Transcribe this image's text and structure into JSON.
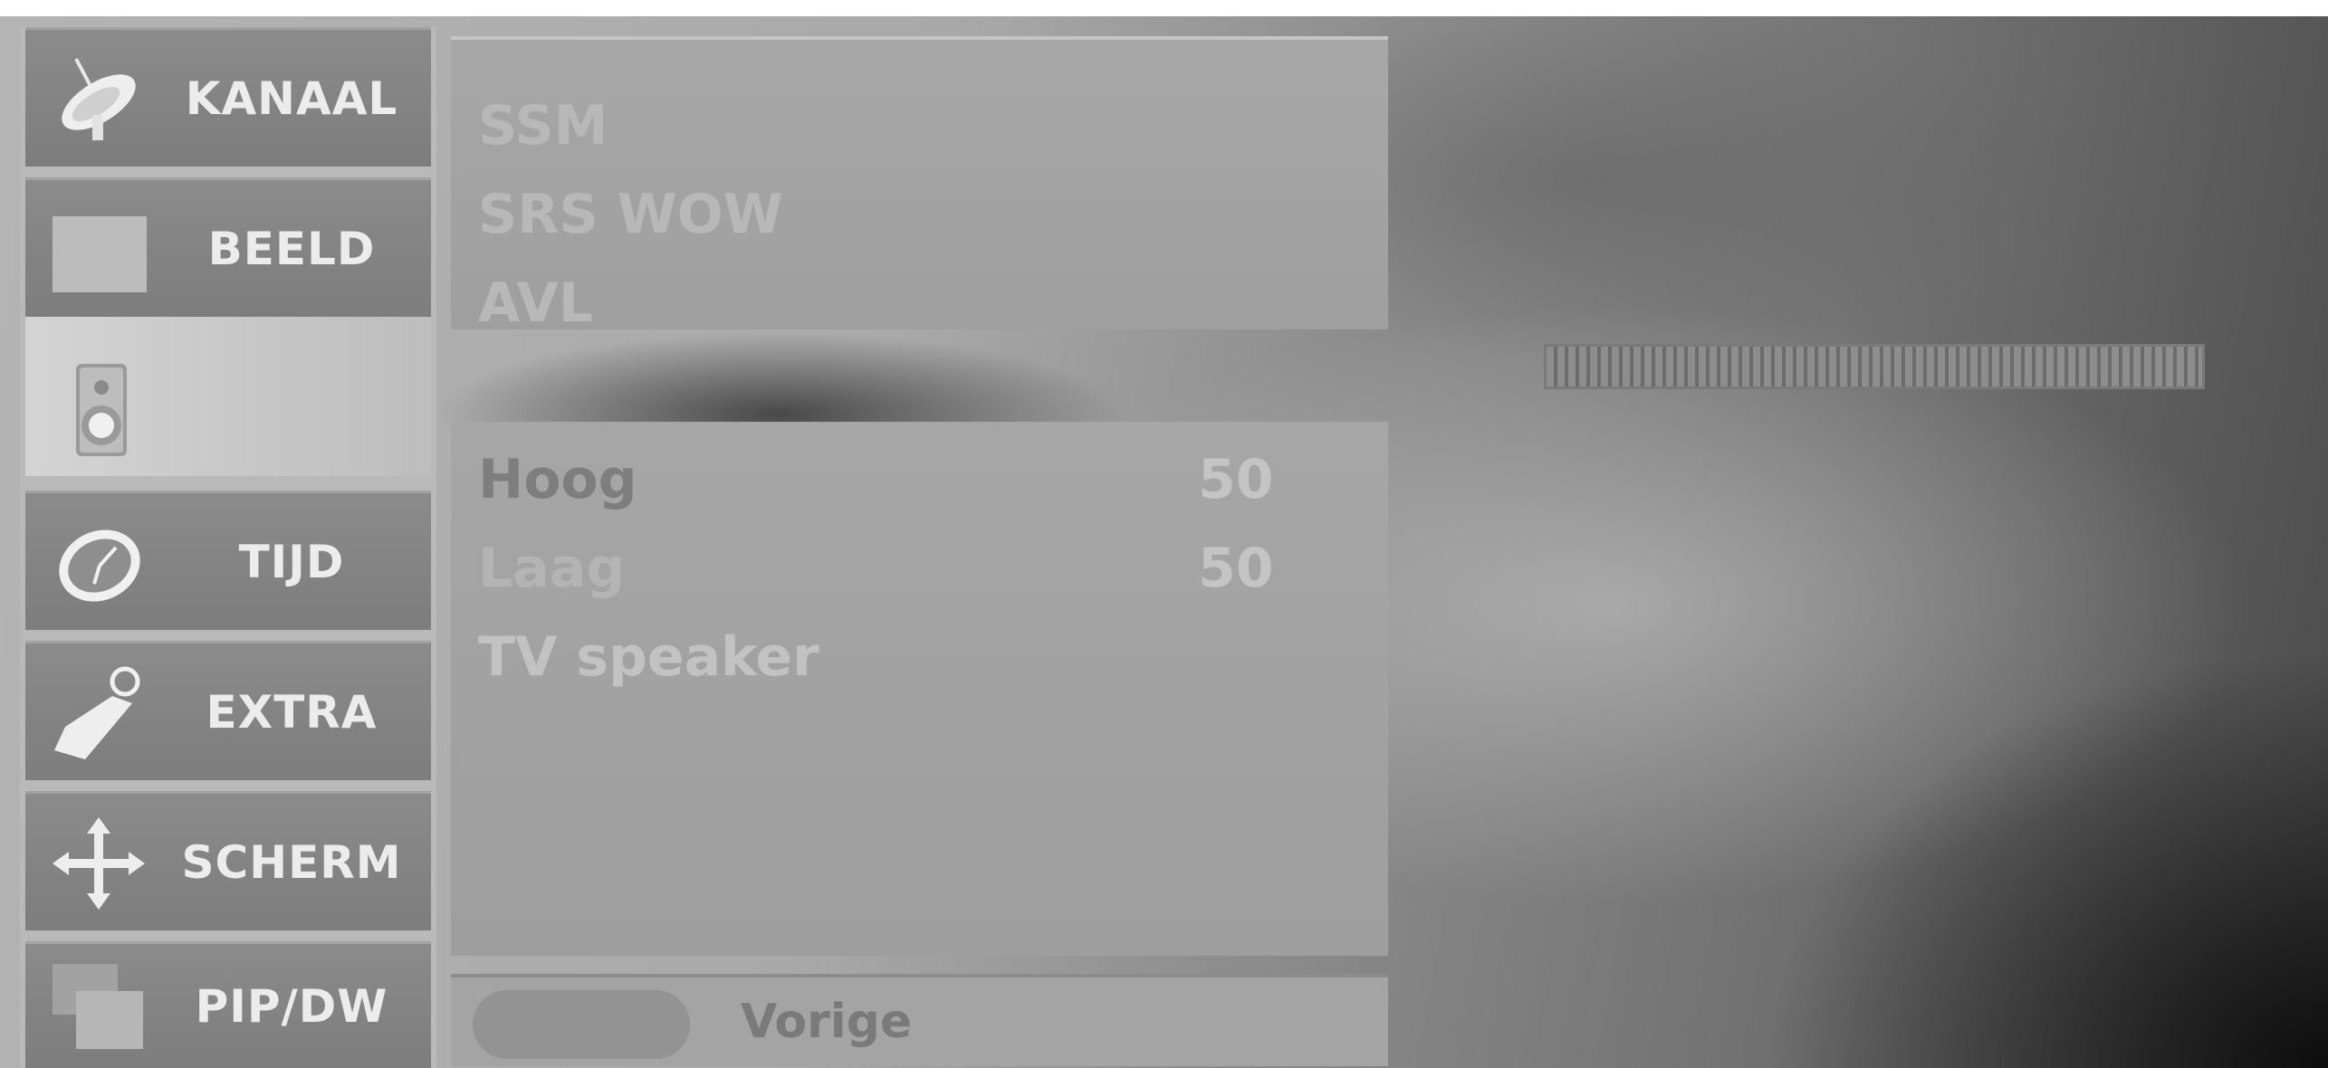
{
  "sidebar": {
    "items": [
      {
        "label": "KANAAL",
        "icon": "satellite-dish-icon"
      },
      {
        "label": "BEELD",
        "icon": "picture-square-icon"
      },
      {
        "label": "",
        "icon": "speaker-icon",
        "selected": true
      },
      {
        "label": "TIJD",
        "icon": "clock-icon"
      },
      {
        "label": "EXTRA",
        "icon": "tag-icon"
      },
      {
        "label": "SCHERM",
        "icon": "move-arrows-icon"
      },
      {
        "label": "PIP/DW",
        "icon": "pip-windows-icon"
      }
    ]
  },
  "audio_menu": {
    "items": [
      "SSM",
      "SRS WOW",
      "AVL"
    ]
  },
  "tone_menu": {
    "rows": [
      {
        "label": "Hoog",
        "value": "50"
      },
      {
        "label": "Laag",
        "value": "50"
      },
      {
        "label": "TV speaker",
        "value": ""
      }
    ]
  },
  "footer": {
    "back_label": "Vorige"
  },
  "level_bar": {
    "fraction": 1.0
  },
  "colors": {
    "tile": "#858585",
    "active_tile": "#cfcfcf",
    "panel": "#a3a3a3",
    "text_light": "#ececec",
    "text_dim": "#7e7e7e"
  }
}
